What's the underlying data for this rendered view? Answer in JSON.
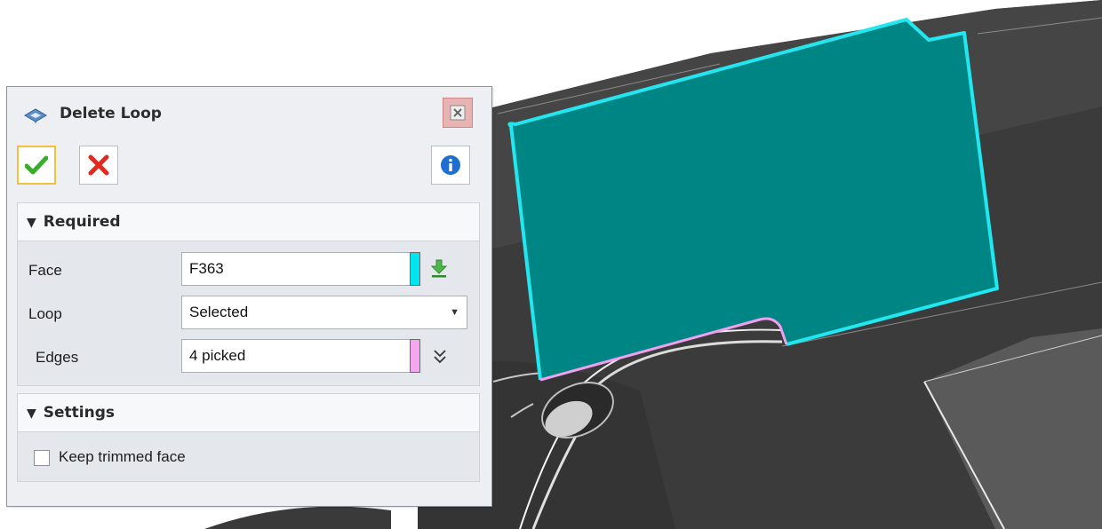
{
  "dialog": {
    "title": "Delete Loop",
    "ok_icon": "checkmark-icon",
    "cancel_icon": "x-icon",
    "info_icon": "info-icon",
    "close_icon": "close-icon"
  },
  "required": {
    "header": "Required",
    "face_label": "Face",
    "face_value": "F363",
    "face_color": "#00e5f0",
    "loop_label": "Loop",
    "loop_value": "Selected",
    "edges_label": "Edges",
    "edges_value": "4 picked",
    "edges_color": "#f4a6ee"
  },
  "settings": {
    "header": "Settings",
    "keep_trimmed_label": "Keep trimmed face",
    "keep_trimmed_checked": false
  },
  "colors": {
    "face_fill": "#008585",
    "face_highlight": "#22e7f0",
    "edge_highlight": "#f0a0f0",
    "model_gray": "#3c3c3c"
  }
}
